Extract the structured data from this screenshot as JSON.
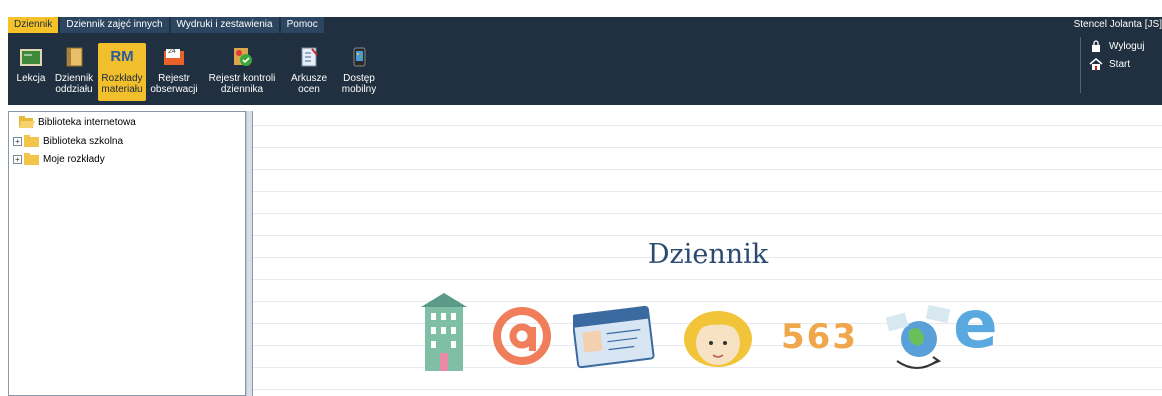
{
  "menu": {
    "tabs": [
      "Dziennik",
      "Dziennik zajęć innych",
      "Wydruki i zestawienia",
      "Pomoc"
    ],
    "active_tab": "Dziennik",
    "user": "Stencel Jolanta [JS]"
  },
  "toolbar": {
    "buttons": [
      {
        "label_1": "Lekcja",
        "label_2": "",
        "icon": "board-icon"
      },
      {
        "label_1": "Dziennik",
        "label_2": "oddziału",
        "icon": "book-icon"
      },
      {
        "label_1": "Rozkłady",
        "label_2": "materiału",
        "icon": "rm-icon",
        "icon_text": "RM",
        "active": true
      },
      {
        "label_1": "Rejestr",
        "label_2": "obserwacji",
        "icon": "folder-24-icon",
        "icon_text": "24"
      },
      {
        "label_1": "Rejestr kontroli",
        "label_2": "dziennika",
        "icon": "check-badge-icon"
      },
      {
        "label_1": "Arkusze",
        "label_2": "ocen",
        "icon": "grade-sheet-icon"
      },
      {
        "label_1": "Dostęp",
        "label_2": "mobilny",
        "icon": "mobile-icon"
      }
    ]
  },
  "side_actions": {
    "logout": "Wyloguj",
    "start": "Start"
  },
  "tree": {
    "items": [
      {
        "label": "Biblioteka internetowa",
        "expandable": false
      },
      {
        "label": "Biblioteka szkolna",
        "expandable": true
      },
      {
        "label": "Moje rozkłady",
        "expandable": true
      }
    ]
  },
  "main": {
    "title": "Dziennik",
    "illustrations": [
      "building-icon",
      "at-sign-icon",
      "id-card-icon",
      "girl-face-icon",
      "numbers-563-icon",
      "globe-mail-icon",
      "letter-e-icon"
    ],
    "numbers_text": "563",
    "e_text": "e"
  },
  "colors": {
    "ribbon": "#203040",
    "active": "#f6c22a",
    "title": "#2b4a72"
  }
}
